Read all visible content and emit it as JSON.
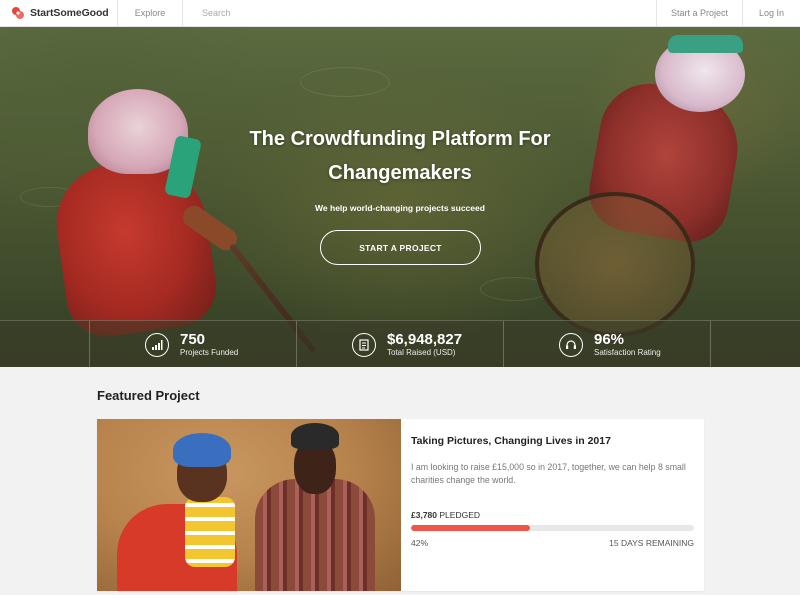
{
  "nav": {
    "logo_text": "StartSomeGood",
    "explore": "Explore",
    "search_placeholder": "Search",
    "start_project": "Start a Project",
    "login": "Log In"
  },
  "hero": {
    "title": "The Crowdfunding Platform For Changemakers",
    "subtitle": "We help world-changing projects succeed",
    "cta": "START A PROJECT"
  },
  "stats": [
    {
      "icon": "bar-chart-icon",
      "value": "750",
      "label": "Projects Funded"
    },
    {
      "icon": "receipt-icon",
      "value": "$6,948,827",
      "label": "Total Raised (USD)"
    },
    {
      "icon": "headset-icon",
      "value": "96%",
      "label": "Satisfaction Rating"
    }
  ],
  "featured": {
    "heading": "Featured Project",
    "project": {
      "title": "Taking Pictures, Changing Lives in 2017",
      "description": "I am looking to raise £15,000 so in 2017, together, we can help 8 small charities change the world.",
      "pledged_amount": "£3,780",
      "pledged_label": "PLEDGED",
      "percent": "42%",
      "progress": 0.42,
      "days_remaining": "15 DAYS REMAINING"
    }
  },
  "colors": {
    "accent": "#ef5548",
    "logo": "#e8463a"
  }
}
